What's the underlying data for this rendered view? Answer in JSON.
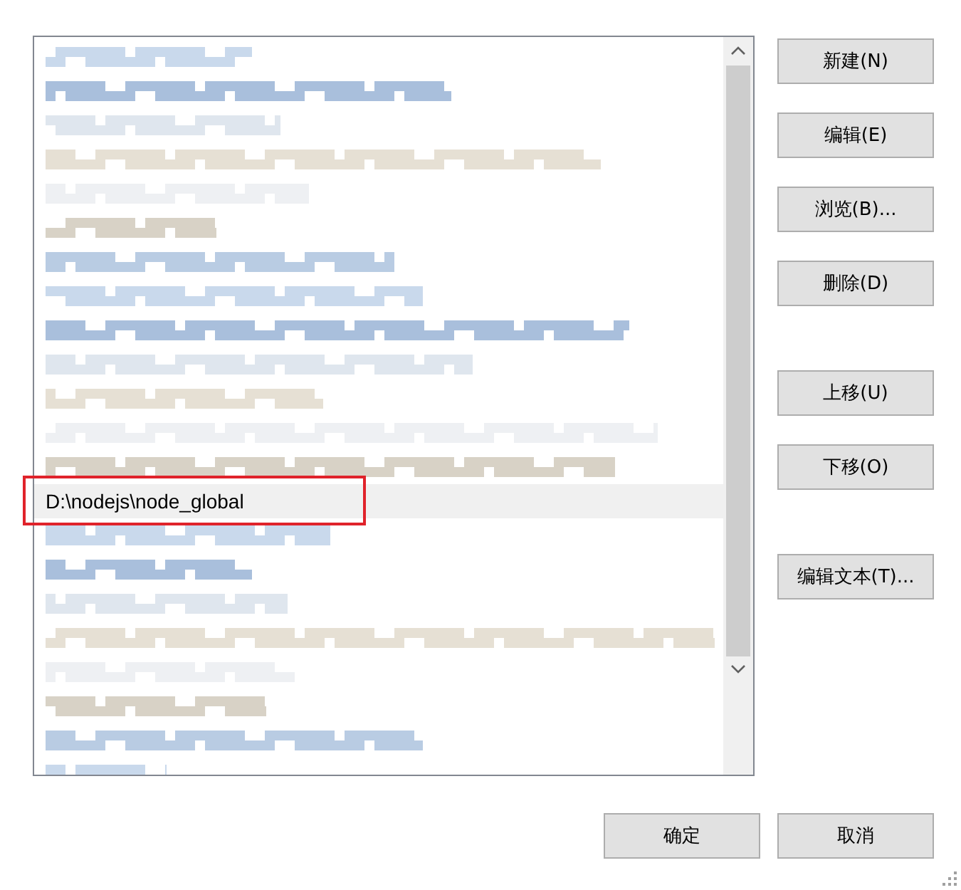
{
  "list": {
    "entries": [
      {
        "kind": "redacted",
        "selected": false
      },
      {
        "kind": "redacted",
        "selected": false
      },
      {
        "kind": "redacted",
        "selected": false
      },
      {
        "kind": "redacted",
        "selected": false
      },
      {
        "kind": "redacted",
        "selected": false
      },
      {
        "kind": "redacted",
        "selected": false
      },
      {
        "kind": "redacted",
        "selected": false
      },
      {
        "kind": "redacted",
        "selected": false
      },
      {
        "kind": "redacted",
        "selected": false
      },
      {
        "kind": "redacted",
        "selected": false
      },
      {
        "kind": "redacted",
        "selected": false
      },
      {
        "kind": "redacted",
        "selected": false
      },
      {
        "kind": "redacted",
        "selected": false
      },
      {
        "kind": "text",
        "text": "D:\\nodejs\\node_global",
        "selected": true
      },
      {
        "kind": "redacted",
        "selected": false
      },
      {
        "kind": "redacted",
        "selected": false
      },
      {
        "kind": "redacted",
        "selected": false
      },
      {
        "kind": "redacted",
        "selected": false
      },
      {
        "kind": "redacted",
        "selected": false
      },
      {
        "kind": "redacted",
        "selected": false
      },
      {
        "kind": "redacted",
        "selected": false
      },
      {
        "kind": "redacted",
        "selected": false
      }
    ]
  },
  "button_groups": [
    [
      "新建(N)",
      "编辑(E)",
      "浏览(B)...",
      "删除(D)"
    ],
    [
      "上移(U)",
      "下移(O)"
    ],
    [
      "编辑文本(T)..."
    ]
  ],
  "footer_buttons": [
    "确定",
    "取消"
  ]
}
